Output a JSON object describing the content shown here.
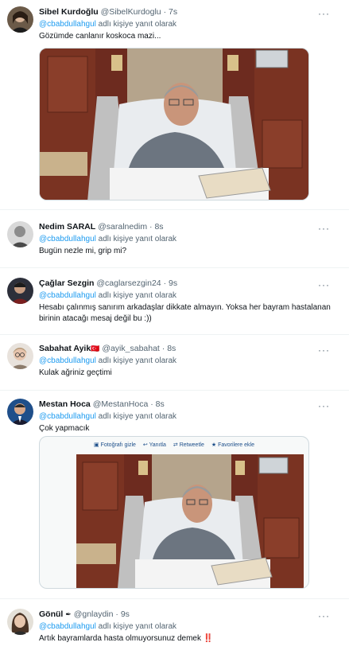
{
  "tweets": [
    {
      "name": "Sibel Kurdoğlu",
      "handle": "@SibelKurdoglu",
      "time": "7s",
      "reply_mention": "@cbabdullahgul",
      "reply_suffix": "adlı kişiye yanıt olarak",
      "text": "Gözümde canlanır koskoca mazi...",
      "has_media": true,
      "avatar_icon": "woman-portrait-avatar"
    },
    {
      "name": "Nedim SARAL",
      "handle": "@saralnedim",
      "time": "8s",
      "reply_mention": "@cbabdullahgul",
      "reply_suffix": "adlı kişiye yanıt olarak",
      "text": "Bugün nezle mi, grip mi?",
      "avatar_icon": "man-grey-avatar"
    },
    {
      "name": "Çağlar Sezgin",
      "handle": "@caglarsezgin24",
      "time": "9s",
      "reply_mention": "@cbabdullahgul",
      "reply_suffix": "adlı kişiye yanıt olarak",
      "text": "Hesabı çalınmış sanırım  arkadaşlar dikkate almayın. Yoksa her bayram hastalanan birinin atacağı mesaj değil bu :))",
      "avatar_icon": "man-dark-avatar"
    },
    {
      "name": "Sabahat Ayik",
      "flag": "🇹🇷",
      "handle": "@ayik_sabahat",
      "time": "8s",
      "reply_mention": "@cbabdullahgul",
      "reply_suffix": "adlı kişiye yanıt olarak",
      "text": "Kulak ağriniz geçtimi",
      "avatar_icon": "woman-glasses-avatar"
    },
    {
      "name": "Mestan Hoca",
      "handle": "@MestanHoca",
      "time": "8s",
      "reply_mention": "@cbabdullahgul",
      "reply_suffix": "adlı kişiye yanıt olarak",
      "text": "Çok yapmacık",
      "avatar_icon": "man-suit-avatar",
      "media_bar": {
        "hide_photo": "Fotoğrafı gizle",
        "reply": "Yanıtla",
        "retweet": "Retweetle",
        "favorite": "Favorilere ekle"
      }
    },
    {
      "name": "Gönül",
      "handle": "@gnlaydin",
      "time": "9s",
      "reply_mention": "@cbabdullahgul",
      "reply_suffix": "adlı kişiye yanıt olarak",
      "text": "Artık bayramlarda hasta olmuyorsunuz demek",
      "emoji": "‼️",
      "avatar_icon": "woman-hair-avatar"
    }
  ],
  "more_label": "···",
  "separator": "·"
}
